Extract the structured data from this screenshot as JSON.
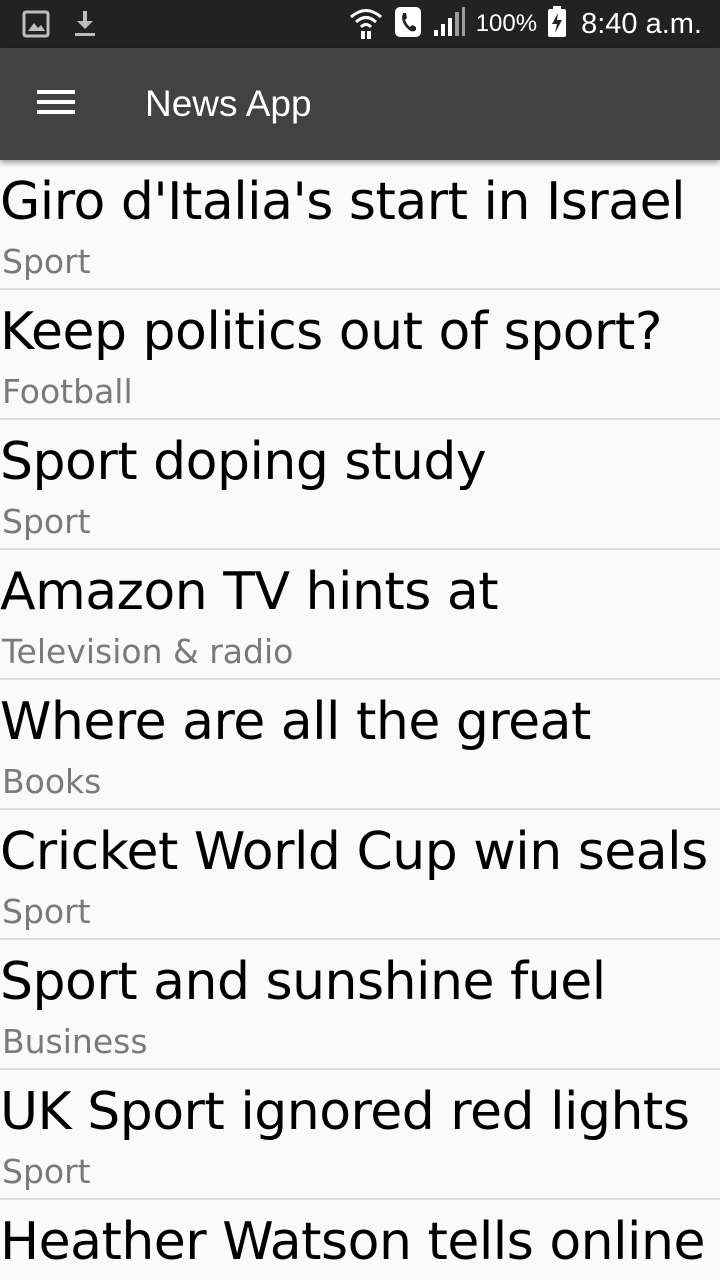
{
  "status_bar": {
    "battery_percent": "100%",
    "time": "8:40 a.m.",
    "icons": [
      "gallery-icon",
      "download-icon",
      "wifi-icon",
      "call-icon",
      "signal-icon",
      "battery-charging-icon"
    ]
  },
  "toolbar": {
    "title": "News App",
    "menu_icon": "menu-icon",
    "background": "#424242"
  },
  "news": [
    {
      "title": "Giro d'Italia's start in Israel",
      "section": "Sport"
    },
    {
      "title": "Keep politics out of sport?",
      "section": "Football"
    },
    {
      "title": "Sport doping study",
      "section": "Sport"
    },
    {
      "title": "Amazon TV hints at",
      "section": "Television & radio"
    },
    {
      "title": "Where are all the great",
      "section": "Books"
    },
    {
      "title": "Cricket World Cup win seals",
      "section": "Sport"
    },
    {
      "title": "Sport and sunshine fuel",
      "section": "Business"
    },
    {
      "title": "UK Sport ignored red lights",
      "section": "Sport"
    },
    {
      "title": "Heather Watson tells online",
      "section": ""
    }
  ]
}
